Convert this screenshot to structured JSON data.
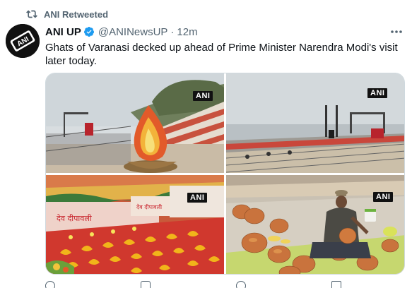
{
  "retweet": {
    "icon": "retweet-icon",
    "label": "ANI Retweeted"
  },
  "author": {
    "name": "ANI UP",
    "handle": "@ANINewsUP",
    "separator": "·",
    "time": "12m",
    "verified_icon": "verified-badge-icon",
    "avatar_label": "ANI"
  },
  "tweet": {
    "text": "Ghats of Varanasi decked up ahead of Prime Minister Narendra Modi's visit later today."
  },
  "media": {
    "photos": [
      {
        "watermark": "ANI",
        "subject": "diya-sculpture-on-ghat"
      },
      {
        "watermark": "ANI",
        "subject": "river-ghat-with-stage"
      },
      {
        "watermark": "ANI",
        "subject": "rangoli-floor-art"
      },
      {
        "watermark": "ANI",
        "subject": "man-painting-earthen-pots"
      }
    ],
    "rangoli_text_1": "देव दीपावली",
    "rangoli_text_2": "देव दीपावली"
  },
  "colors": {
    "accent": "#1d9bf0",
    "secondary_text": "#536471",
    "primary_text": "#0f1419"
  }
}
